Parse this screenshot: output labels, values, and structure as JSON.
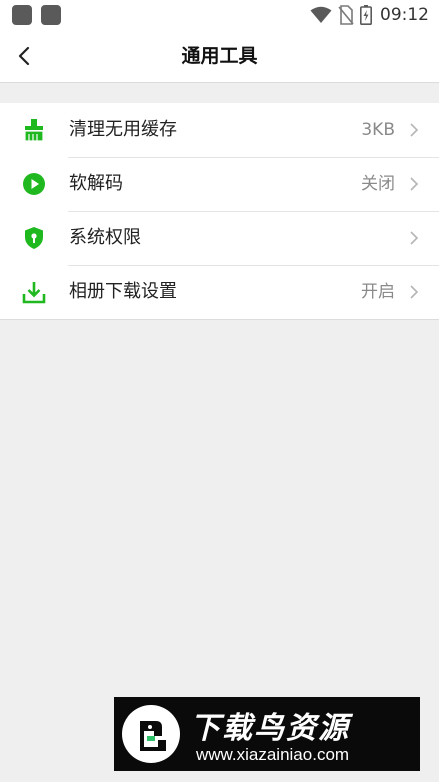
{
  "status_bar": {
    "time": "09:12",
    "icons": [
      "app-notification-icon",
      "app-notification-icon",
      "wifi-icon",
      "no-sim-icon",
      "battery-charging-icon"
    ]
  },
  "header": {
    "back_icon": "back-arrow-icon",
    "title": "通用工具"
  },
  "menu": {
    "items": [
      {
        "label": "清理无用缓存",
        "value": "3KB",
        "icon": "broom-icon"
      },
      {
        "label": "软解码",
        "value": "关闭",
        "icon": "play-circle-icon"
      },
      {
        "label": "系统权限",
        "value": "",
        "icon": "shield-icon"
      },
      {
        "label": "相册下载设置",
        "value": "开启",
        "icon": "download-icon"
      }
    ]
  },
  "watermark": {
    "title": "下载鸟资源",
    "url": "www.xiazainiao.com"
  },
  "colors": {
    "accent": "#1fb91f",
    "background": "#efefef",
    "secondary_text": "#8a8a8a"
  }
}
